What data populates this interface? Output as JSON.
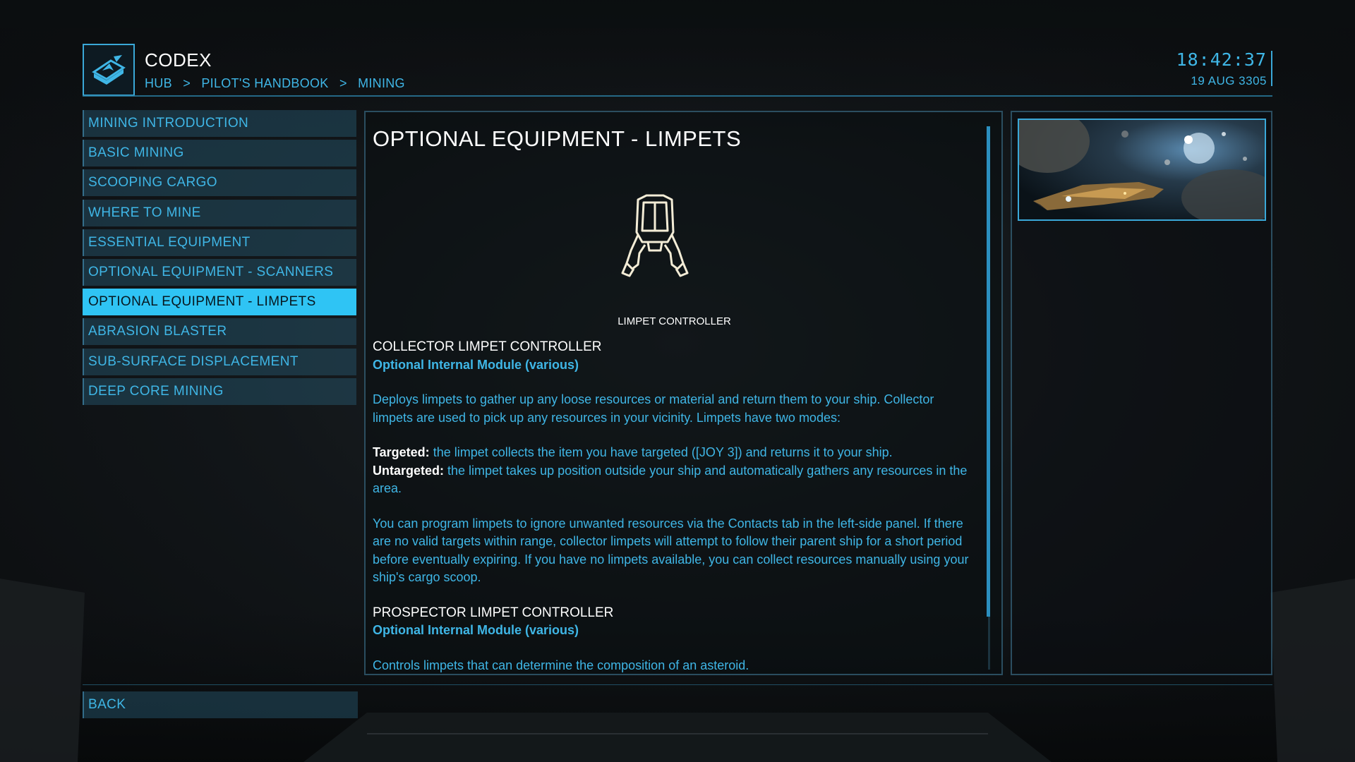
{
  "header": {
    "title": "CODEX",
    "breadcrumb": [
      "HUB",
      ">",
      "PILOT'S HANDBOOK",
      ">",
      "MINING"
    ],
    "time": "18:42:37",
    "date": "19 AUG 3305",
    "icon": "codex-book-icon"
  },
  "nav": {
    "items": [
      {
        "label": "MINING INTRODUCTION"
      },
      {
        "label": "BASIC MINING"
      },
      {
        "label": "SCOOPING CARGO"
      },
      {
        "label": "WHERE TO MINE"
      },
      {
        "label": "ESSENTIAL EQUIPMENT"
      },
      {
        "label": "OPTIONAL EQUIPMENT - SCANNERS"
      },
      {
        "label": "OPTIONAL EQUIPMENT - LIMPETS"
      },
      {
        "label": "ABRASION BLASTER"
      },
      {
        "label": "SUB-SURFACE DISPLACEMENT"
      },
      {
        "label": "DEEP CORE MINING"
      }
    ],
    "active_index": 6
  },
  "article": {
    "title": "OPTIONAL EQUIPMENT - LIMPETS",
    "figure_caption": "LIMPET CONTROLLER",
    "figure_icon": "limpet-drone-icon",
    "section1_title": "COLLECTOR LIMPET CONTROLLER",
    "section1_sub": "Optional Internal Module (various)",
    "section1_p1": "Deploys limpets to gather up any loose resources or material and return them to your ship. Collector limpets are used to pick up any resources in your vicinity. Limpets have two modes:",
    "targeted_label": "Targeted:",
    "targeted_text": " the limpet collects the item you have targeted ([JOY 3]) and returns it to your ship.",
    "untargeted_label": "Untargeted:",
    "untargeted_text": " the limpet takes up position outside your ship and automatically gathers any resources in the area.",
    "section1_p2": "You can program limpets to ignore unwanted resources via the Contacts tab in the left-side panel. If there are no valid targets within range, collector limpets will attempt to follow their parent ship for a short period before eventually expiring. If you have no limpets available, you can collect resources manually using your ship's cargo scoop.",
    "section2_title": "PROSPECTOR LIMPET CONTROLLER",
    "section2_sub": "Optional Internal Module (various)",
    "section2_p1": "Controls limpets that can determine the composition of an asteroid."
  },
  "footer": {
    "back_label": "BACK"
  },
  "colors": {
    "accent": "#3fb6e6",
    "active_bg": "#2fc4f4",
    "heading": "#ffffff"
  }
}
